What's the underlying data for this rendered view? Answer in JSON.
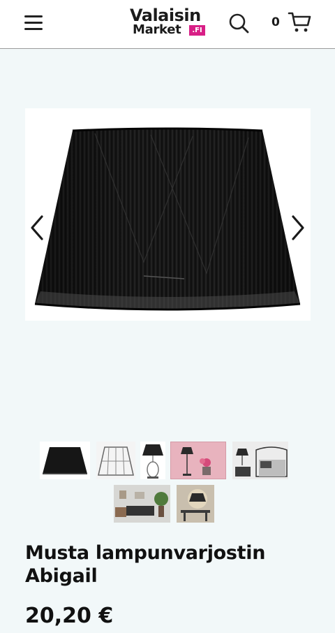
{
  "header": {
    "logo_line1": "Valaisin",
    "logo_line2": "Market",
    "logo_suffix": ".FI",
    "cart_count": "0"
  },
  "icons": {
    "menu": "hamburger-icon",
    "search": "search-icon",
    "cart": "shopping-cart-icon",
    "prev": "chevron-left-icon",
    "next": "chevron-right-icon"
  },
  "colors": {
    "brand_pink": "#d81f86",
    "page_background": "#f2f8f9",
    "text": "#111111"
  },
  "gallery": {
    "thumbnail_count": 7,
    "active_thumbnail": 1
  },
  "product": {
    "title": "Musta lampunvarjostin Abigail",
    "price": "20,20 €"
  }
}
